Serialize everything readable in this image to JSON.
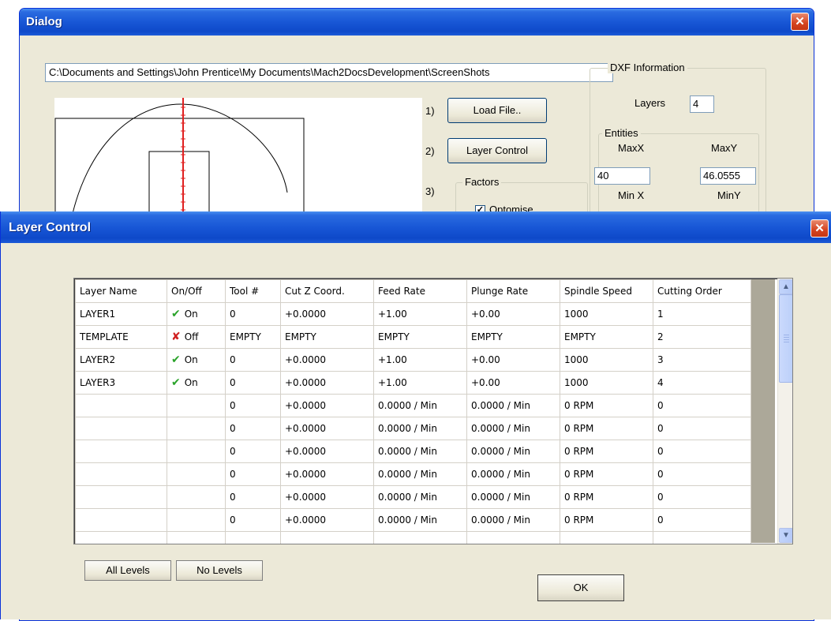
{
  "dialog": {
    "title": "Dialog",
    "path": "C:\\Documents and Settings\\John Prentice\\My Documents\\Mach2DocsDevelopment\\ScreenShots",
    "steps": [
      {
        "num": "1)",
        "button": "Load File.."
      },
      {
        "num": "2)",
        "button": "Layer Control"
      },
      {
        "num": "3)"
      }
    ],
    "factors": {
      "label": "Factors",
      "optimise_label": "Optomise",
      "optimise_checked": true
    },
    "dxf_info": {
      "label": "DXF Information",
      "layers_label": "Layers",
      "layers_value": "4",
      "entities_label": "Entities",
      "maxx_label": "MaxX",
      "maxy_label": "MaxY",
      "maxx_value": "40",
      "maxy_value": "46.0555",
      "minx_label": "Min X",
      "miny_label": "MinY"
    }
  },
  "layer_control": {
    "title": "Layer Control",
    "columns": [
      "Layer Name",
      "On/Off",
      "Tool #",
      "Cut Z Coord.",
      "Feed Rate",
      "Plunge Rate",
      "Spindle Speed",
      "Cutting Order"
    ],
    "rows": [
      {
        "name": "LAYER1",
        "state": "on",
        "state_label": "On",
        "tool": "0",
        "cutz": "+0.0000",
        "feed": "+1.00",
        "plunge": "+0.00",
        "spindle": "1000",
        "order": "1"
      },
      {
        "name": "TEMPLATE",
        "state": "off",
        "state_label": "Off",
        "tool": "EMPTY",
        "cutz": "EMPTY",
        "feed": "EMPTY",
        "plunge": "EMPTY",
        "spindle": "EMPTY",
        "order": "2"
      },
      {
        "name": "LAYER2",
        "state": "on",
        "state_label": "On",
        "tool": "0",
        "cutz": "+0.0000",
        "feed": "+1.00",
        "plunge": "+0.00",
        "spindle": "1000",
        "order": "3"
      },
      {
        "name": "LAYER3",
        "state": "on",
        "state_label": "On",
        "tool": "0",
        "cutz": "+0.0000",
        "feed": "+1.00",
        "plunge": "+0.00",
        "spindle": "1000",
        "order": "4"
      },
      {
        "name": "",
        "state": "",
        "state_label": "",
        "tool": "0",
        "cutz": "+0.0000",
        "feed": "0.0000 / Min",
        "plunge": "0.0000 / Min",
        "spindle": "0 RPM",
        "order": "0"
      },
      {
        "name": "",
        "state": "",
        "state_label": "",
        "tool": "0",
        "cutz": "+0.0000",
        "feed": "0.0000 / Min",
        "plunge": "0.0000 / Min",
        "spindle": "0 RPM",
        "order": "0"
      },
      {
        "name": "",
        "state": "",
        "state_label": "",
        "tool": "0",
        "cutz": "+0.0000",
        "feed": "0.0000 / Min",
        "plunge": "0.0000 / Min",
        "spindle": "0 RPM",
        "order": "0"
      },
      {
        "name": "",
        "state": "",
        "state_label": "",
        "tool": "0",
        "cutz": "+0.0000",
        "feed": "0.0000 / Min",
        "plunge": "0.0000 / Min",
        "spindle": "0 RPM",
        "order": "0"
      },
      {
        "name": "",
        "state": "",
        "state_label": "",
        "tool": "0",
        "cutz": "+0.0000",
        "feed": "0.0000 / Min",
        "plunge": "0.0000 / Min",
        "spindle": "0 RPM",
        "order": "0"
      },
      {
        "name": "",
        "state": "",
        "state_label": "",
        "tool": "0",
        "cutz": "+0.0000",
        "feed": "0.0000 / Min",
        "plunge": "0.0000 / Min",
        "spindle": "0 RPM",
        "order": "0"
      },
      {
        "name": "",
        "state": "",
        "state_label": "",
        "tool": "",
        "cutz": "",
        "feed": "",
        "plunge": "",
        "spindle": "",
        "order": ""
      }
    ],
    "buttons": {
      "all_levels": "All Levels",
      "no_levels": "No Levels",
      "ok": "OK"
    }
  },
  "icons": {
    "on": "green-check-icon",
    "off": "red-x-icon",
    "close": "close-icon"
  },
  "colors": {
    "titlebar": "#0e49c9",
    "dialog_bg": "#ece9d8",
    "close_red": "#d5431f",
    "check_green": "#2aa32a",
    "cross_red": "#d02020"
  }
}
